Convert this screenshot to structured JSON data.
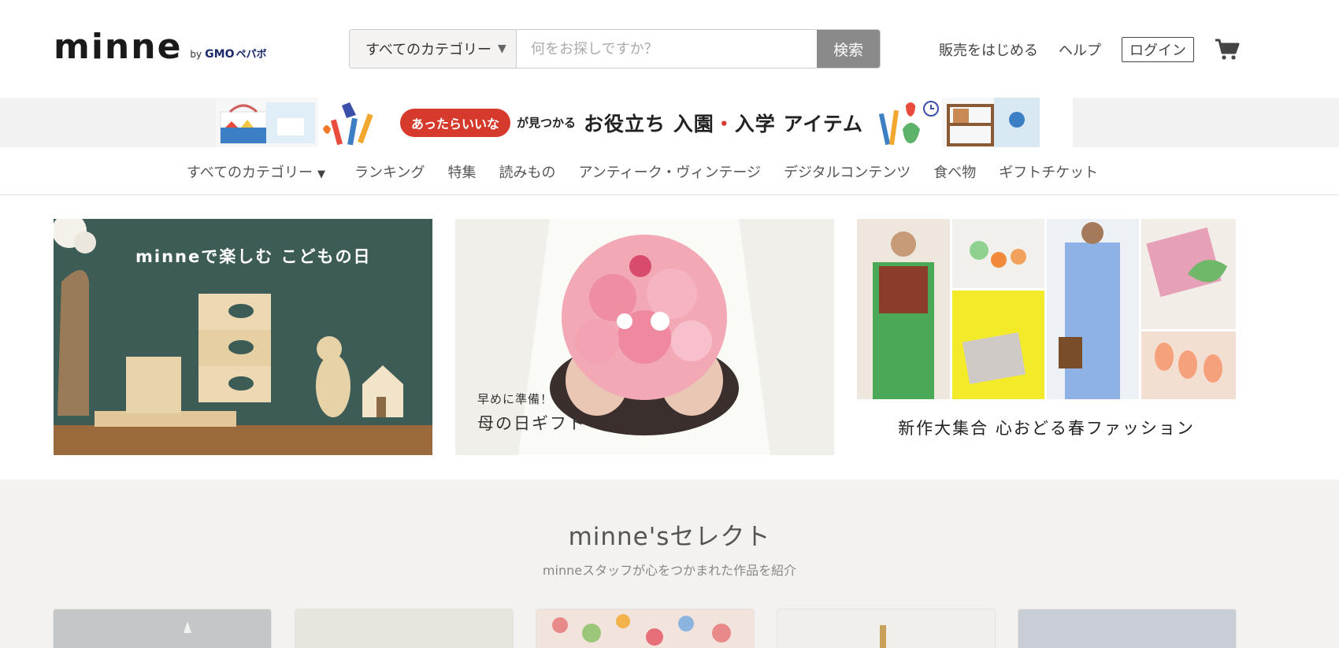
{
  "header": {
    "logo_main": "minne",
    "logo_by": "by",
    "logo_gmo": "GMO",
    "logo_pepabo": "ペパボ",
    "search_category": "すべてのカテゴリー",
    "search_placeholder": "何をお探しですか？",
    "search_button": "検索",
    "link_sell": "販売をはじめる",
    "link_help": "ヘルプ",
    "link_login": "ログイン",
    "cart_icon": "cart-icon"
  },
  "banner": {
    "pill": "あったらいいな",
    "small": "が見つかる",
    "big_a": "お役立ち",
    "big_b": "入園",
    "big_dot": "・",
    "big_c": "入学",
    "big_d": "アイテム"
  },
  "catnav": {
    "items": [
      "すべてのカテゴリー",
      "ランキング",
      "特集",
      "読みもの",
      "アンティーク・ヴィンテージ",
      "デジタルコンテンツ",
      "食べ物",
      "ギフトチケット"
    ]
  },
  "hero": {
    "card1_text": "minneで楽しむ こどもの日",
    "card2_small": "早めに準備！",
    "card2_big": "母の日ギフト",
    "card3_text": "新作大集合 心おどる春ファッション"
  },
  "select": {
    "title": "minne'sセレクト",
    "subtitle": "minneスタッフが心をつかまれた作品を紹介"
  },
  "colors": {
    "accent_red": "#d53a2c",
    "search_button": "#8a8a8a",
    "select_bg": "#f3f2f0",
    "card1_bg": "#3e5c56"
  }
}
